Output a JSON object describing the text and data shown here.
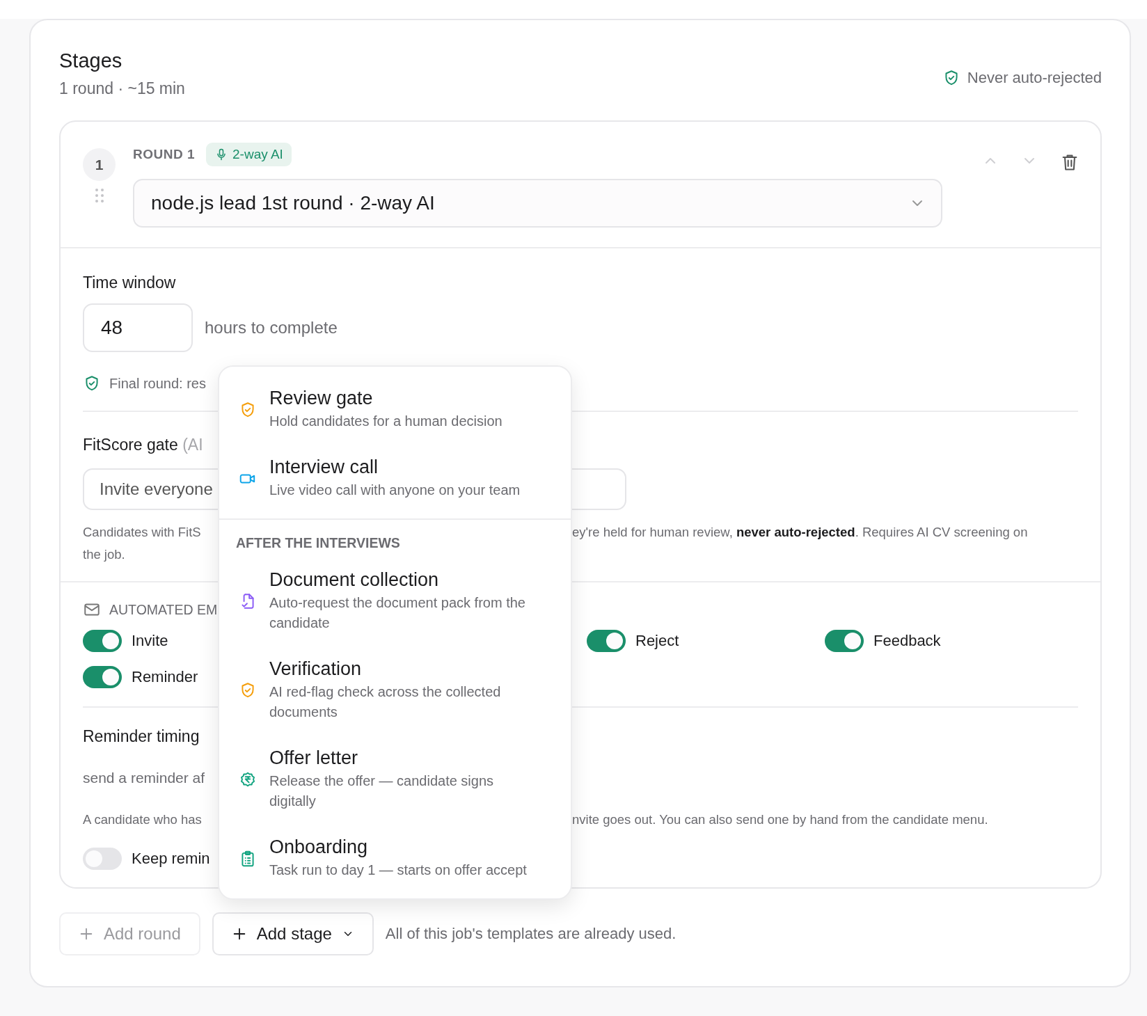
{
  "header": {
    "title": "Stages",
    "subtitle": "1 round · ~15 min",
    "badge": "Never auto-rejected"
  },
  "round": {
    "number": "1",
    "label": "ROUND 1",
    "mode_badge": "2-way AI",
    "move_up": {
      "disabled": true
    },
    "move_down": {
      "disabled": true
    },
    "template_select": {
      "value": "node.js lead 1st round · 2-way AI"
    }
  },
  "time_window": {
    "label": "Time window",
    "value": "48",
    "unit": "hours to complete",
    "note": "Final round: res"
  },
  "fitscore_gate": {
    "label": "FitScore gate",
    "label_suffix": "(AI",
    "select_value": "Invite everyone",
    "help_left": "Candidates with FitS",
    "help_left_2": "the job.",
    "help_right": "ey're held for human review, **never auto-rejected**. Requires AI CV screening on"
  },
  "automated_emails": {
    "heading": "AUTOMATED EM",
    "left_toggles": [
      {
        "label": "Invite",
        "on": true
      },
      {
        "label": "Reminder",
        "on": true
      }
    ],
    "right_toggles": [
      {
        "label": "Reject",
        "on": true
      },
      {
        "label": "Feedback",
        "on": true
      }
    ]
  },
  "reminder_timing": {
    "label": "Reminder timing",
    "sentence": "send a reminder af",
    "help_left": "A candidate who has",
    "help_right": "nvite goes out. You can also send one by hand from the candidate menu.",
    "keep_toggle": {
      "label": "Keep remin",
      "on": false
    }
  },
  "footer": {
    "add_round": {
      "label": "Add round",
      "disabled": true
    },
    "add_stage": {
      "label": "Add stage"
    },
    "note": "All of this job's templates are already used."
  },
  "stage_menu": {
    "groups": [
      {
        "items": [
          {
            "kind": "shield",
            "color": "#f59e0b",
            "title": "Review gate",
            "description": "Hold candidates for a human decision"
          },
          {
            "kind": "video",
            "color": "#0ea5e9",
            "title": "Interview call",
            "description": "Live video call with anyone on your team"
          }
        ]
      },
      {
        "heading": "AFTER THE INTERVIEWS",
        "items": [
          {
            "kind": "document",
            "color": "#8b5cf6",
            "title": "Document collection",
            "description": "Auto-request the document pack from the candidate"
          },
          {
            "kind": "shield",
            "color": "#f59e0b",
            "title": "Verification",
            "description": "AI red-flag check across the collected documents"
          },
          {
            "kind": "rupee",
            "color": "#10a37f",
            "title": "Offer letter",
            "description": "Release the offer — candidate signs digitally"
          },
          {
            "kind": "clipboard",
            "color": "#10a37f",
            "title": "Onboarding",
            "description": "Task run to day 1 — starts on offer accept"
          }
        ]
      }
    ]
  }
}
